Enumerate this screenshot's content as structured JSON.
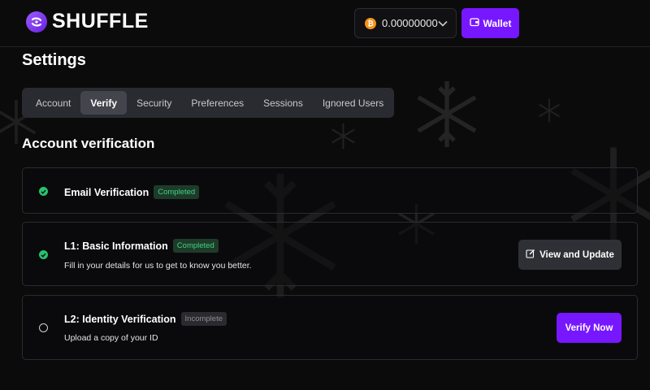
{
  "brand": {
    "name": "SHUFFLE",
    "accent": "#7717ff"
  },
  "header": {
    "balance": {
      "value": "0.00000000",
      "coin_icon": "bitcoin-icon",
      "coin_symbol": "₿"
    },
    "wallet_label": "Wallet"
  },
  "page": {
    "title": "Settings"
  },
  "tabs": [
    {
      "label": "Account",
      "active": false
    },
    {
      "label": "Verify",
      "active": true
    },
    {
      "label": "Security",
      "active": false
    },
    {
      "label": "Preferences",
      "active": false
    },
    {
      "label": "Sessions",
      "active": false
    },
    {
      "label": "Ignored Users",
      "active": false
    }
  ],
  "verification": {
    "section_title": "Account verification",
    "items": [
      {
        "title": "Email Verification",
        "status": "Completed",
        "status_color": "#3fd37d"
      },
      {
        "title": "L1: Basic Information",
        "status": "Completed",
        "status_color": "#3fd37d",
        "description": "Fill in your details for us to get to know you better.",
        "action": "View and Update"
      },
      {
        "title": "L2: Identity Verification",
        "status": "Incomplete",
        "status_color": "#8b8b92",
        "description": "Upload a copy of your ID",
        "action": "Verify Now"
      }
    ]
  }
}
